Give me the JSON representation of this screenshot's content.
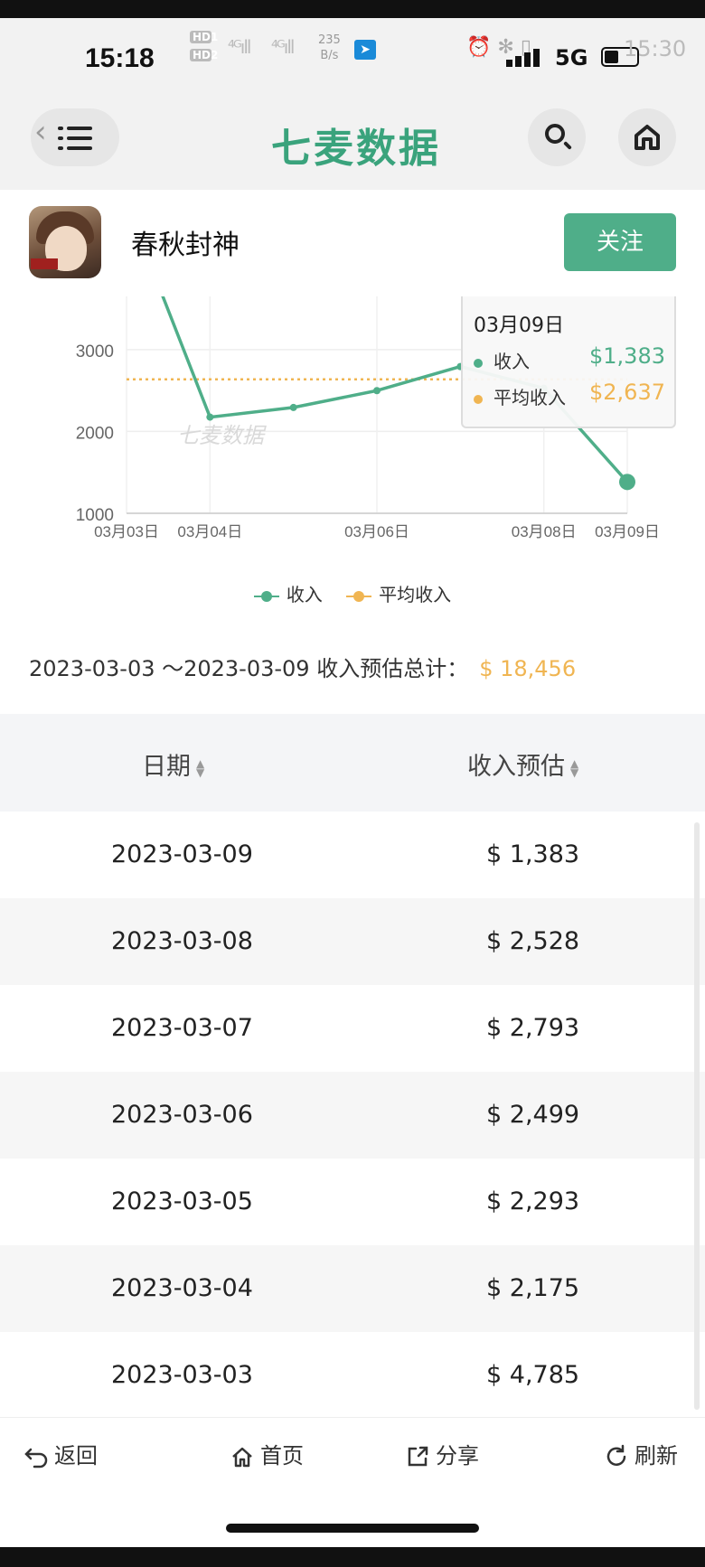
{
  "status_bar": {
    "time": "15:18",
    "speed_value": "235",
    "speed_unit": "B/s",
    "network": "5G",
    "time_right": "15:30",
    "battery_level": 0.45
  },
  "header": {
    "brand": "七麦数据"
  },
  "app": {
    "name": "春秋封神",
    "follow_label": "关注"
  },
  "chart_data": {
    "type": "line",
    "x": [
      "03月03日",
      "03月04日",
      "03月05日",
      "03月06日",
      "03月07日",
      "03月08日",
      "03月09日"
    ],
    "x_tick_labels": [
      "03月03日",
      "03月04日",
      "03月06日",
      "03月08日",
      "03月09日"
    ],
    "series": [
      {
        "name": "收入",
        "values": [
          4785,
          2175,
          2293,
          2499,
          2793,
          2528,
          1383
        ],
        "color": "#4fae89"
      },
      {
        "name": "平均收入",
        "values": [
          2637,
          2637,
          2637,
          2637,
          2637,
          2637,
          2637
        ],
        "color": "#f0b552"
      }
    ],
    "y_tick_labels": [
      "1000",
      "2000",
      "3000"
    ],
    "ylim": [
      1000,
      3650
    ],
    "watermark": "七麦数据",
    "legend_position": "bottom",
    "grid": true,
    "tooltip": {
      "date": "03月09日",
      "income_label": "收入",
      "income_value": "$1,383",
      "avg_label": "平均收入",
      "avg_value": "$2,637"
    }
  },
  "legend": {
    "income": "收入",
    "avg": "平均收入"
  },
  "summary": {
    "range": "2023-03-03 ～2023-03-09 收入预估总计：",
    "total": "$ 18,456"
  },
  "table": {
    "col_date": "日期",
    "col_income": "收入预估",
    "rows": [
      {
        "date": "2023-03-09",
        "income": "$ 1,383"
      },
      {
        "date": "2023-03-08",
        "income": "$ 2,528"
      },
      {
        "date": "2023-03-07",
        "income": "$ 2,793"
      },
      {
        "date": "2023-03-06",
        "income": "$ 2,499"
      },
      {
        "date": "2023-03-05",
        "income": "$ 2,293"
      },
      {
        "date": "2023-03-04",
        "income": "$ 2,175"
      },
      {
        "date": "2023-03-03",
        "income": "$ 4,785"
      }
    ]
  },
  "bottom_nav": {
    "back": "返回",
    "home": "首页",
    "share": "分享",
    "refresh": "刷新"
  },
  "icons": {
    "menu": "menu-icon",
    "search": "search-icon",
    "home": "home-icon",
    "back": "back-arrow-icon",
    "share": "share-icon",
    "refresh": "refresh-icon"
  }
}
